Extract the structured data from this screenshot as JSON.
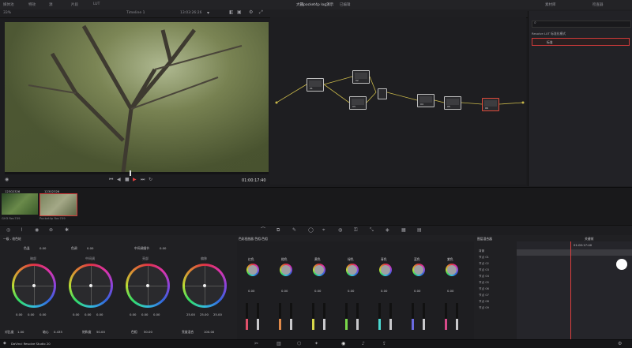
{
  "header": {
    "project_title": "大疆pocket4p log演示",
    "status": "已编辑",
    "menu_items": [
      "媒体池",
      "特效",
      "源",
      "片段",
      "LUT"
    ],
    "timeline_name": "Timeline 1",
    "clip_timecode": "13:03:26:26",
    "zoom": "33%",
    "right_tab": "素材库",
    "right_tab2": "检查器"
  },
  "viewer": {
    "timecode": "01:00:17:40"
  },
  "right_panel": {
    "search_placeholder": "",
    "section_title": "Resolve LUT 标准化模式",
    "selected_item": "标准"
  },
  "clips": [
    {
      "label": "12302326",
      "name": "GH3 Rec709"
    },
    {
      "label": "12302326",
      "name": "Pocket4p Rec709"
    }
  ],
  "color": {
    "header_label": "一级 - 校色轮",
    "mode_label": "调色面板",
    "params": [
      {
        "name": "对比度",
        "value": "1.00"
      },
      {
        "name": "轴心",
        "value": "0.435"
      },
      {
        "name": "饱和度",
        "value": "50.00"
      },
      {
        "name": "色相",
        "value": "50.00"
      },
      {
        "name": "亮度混合",
        "value": "100.00"
      }
    ],
    "top_params": [
      {
        "name": "色温",
        "value": "0.00"
      },
      {
        "name": "色调",
        "value": "0.00"
      },
      {
        "name": "中间调细节",
        "value": "0.00"
      }
    ],
    "wheels": [
      {
        "name": "暗部",
        "r": "0.00",
        "g": "0.00",
        "b": "0.00"
      },
      {
        "name": "中间调",
        "r": "0.00",
        "g": "0.00",
        "b": "0.00"
      },
      {
        "name": "亮部",
        "r": "0.00",
        "g": "0.00",
        "b": "0.00"
      },
      {
        "name": "偏移",
        "r": "25.00",
        "g": "25.00",
        "b": "25.00"
      }
    ],
    "bottom_params": [
      {
        "name": "对比度",
        "value": "1.00"
      },
      {
        "name": "轴心",
        "value": "0.435"
      },
      {
        "name": "饱和度",
        "value": "50.00"
      },
      {
        "name": "色相",
        "value": "50.00"
      },
      {
        "name": "亮度混合",
        "value": "100.00"
      }
    ]
  },
  "hsl": {
    "header_label": "色彩扭曲器 色相-色相",
    "channels": [
      {
        "name": "红色",
        "value": "0.00"
      },
      {
        "name": "橙色",
        "value": "0.00"
      },
      {
        "name": "黄色",
        "value": "0.00"
      },
      {
        "name": "绿色",
        "value": "0.00"
      },
      {
        "name": "青色",
        "value": "0.00"
      },
      {
        "name": "蓝色",
        "value": "0.00"
      },
      {
        "name": "紫色",
        "value": "0.00"
      },
      {
        "name": "品红",
        "value": "0.00"
      }
    ]
  },
  "layers": {
    "title": "图层混合器",
    "items": [
      "背景",
      "节点 01",
      "节点 02",
      "节点 03",
      "节点 04",
      "节点 05",
      "节点 06",
      "节点 07",
      "节点 08",
      "节点 09"
    ]
  },
  "timeline_panel": {
    "title": "关键帧",
    "timecode": "01:00:17:40"
  },
  "statusbar": {
    "app": "DaVinci Resolve Studio 20"
  }
}
